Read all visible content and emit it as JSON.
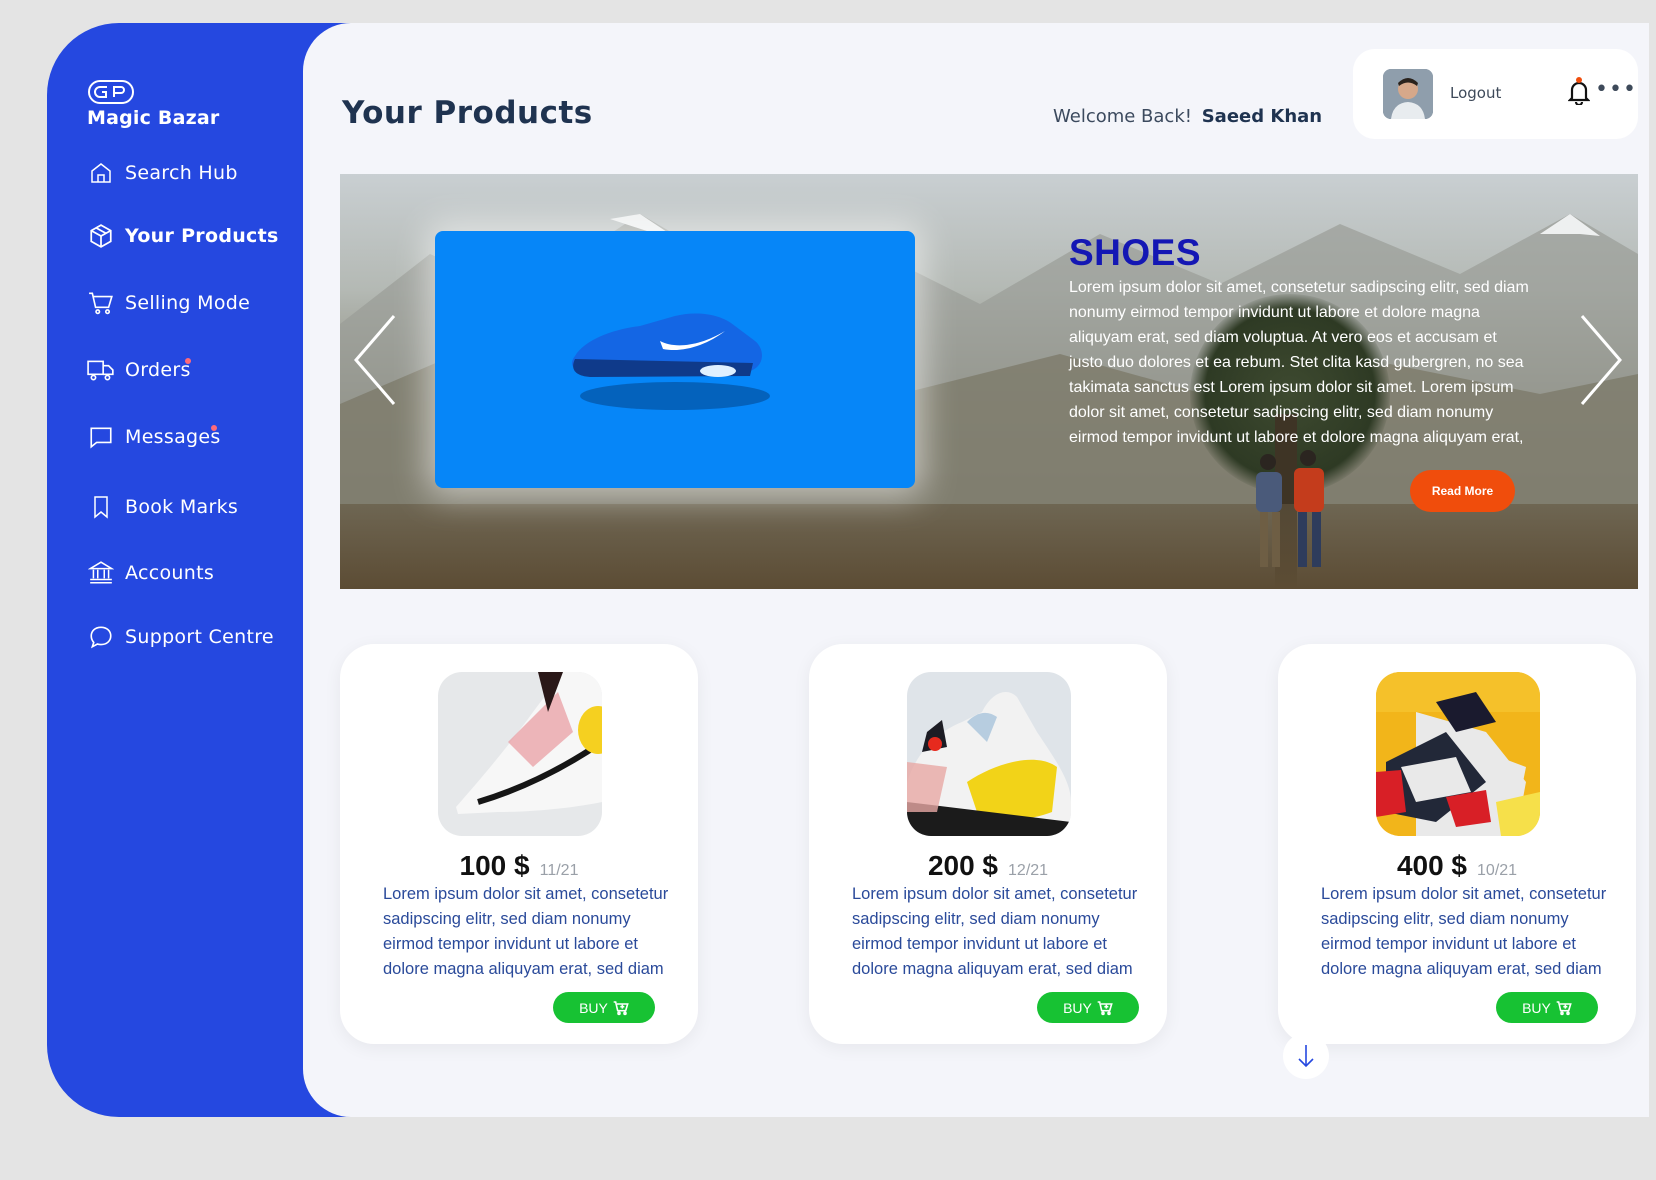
{
  "app": {
    "name": "Magic Bazar"
  },
  "sidebar": {
    "items": [
      {
        "label": "Search Hub",
        "icon": "home-icon"
      },
      {
        "label": "Your Products",
        "icon": "box-icon"
      },
      {
        "label": "Selling Mode",
        "icon": "cart-icon"
      },
      {
        "label": "Orders",
        "icon": "truck-icon"
      },
      {
        "label": "Messages",
        "icon": "message-icon"
      },
      {
        "label": "Book Marks",
        "icon": "bookmark-icon"
      },
      {
        "label": "Accounts",
        "icon": "bank-icon"
      },
      {
        "label": "Support Centre",
        "icon": "chat-bubble-icon"
      }
    ]
  },
  "header": {
    "title": "Your Products",
    "welcome_text": "Welcome Back!",
    "user_name": "Saeed Khan",
    "logout_label": "Logout"
  },
  "banner": {
    "title": "SHOES",
    "text": "Lorem ipsum dolor sit amet, consetetur sadipscing elitr, sed diam nonumy eirmod tempor invidunt ut labore et dolore magna aliquyam erat, sed diam voluptua. At vero eos et accusam et justo duo dolores et ea rebum. Stet clita kasd gubergren, no sea takimata sanctus est Lorem ipsum dolor sit amet. Lorem ipsum dolor sit amet, consetetur sadipscing elitr, sed diam nonumy eirmod tempor invidunt ut labore et dolore magna aliquyam erat,",
    "button_label": "Read More"
  },
  "products": [
    {
      "price": "100 $",
      "date": "11/21",
      "description": "Lorem ipsum dolor sit amet, consetetur sadipscing elitr, sed diam nonumy eirmod tempor invidunt ut labore et dolore magna aliquyam erat, sed diam",
      "button_label": "BUY"
    },
    {
      "price": "200 $",
      "date": "12/21",
      "description": "Lorem ipsum dolor sit amet, consetetur sadipscing elitr, sed diam nonumy eirmod tempor invidunt ut labore et dolore magna aliquyam erat, sed diam",
      "button_label": "BUY"
    },
    {
      "price": "400 $",
      "date": "10/21",
      "description": "Lorem ipsum dolor sit amet, consetetur sadipscing elitr, sed diam nonumy eirmod tempor invidunt ut labore et dolore magna aliquyam erat, sed diam",
      "button_label": "BUY"
    }
  ],
  "colors": {
    "sidebar": "#2548e0",
    "accent_orange": "#f04d0c",
    "buy_green": "#17c233",
    "banner_title": "#1417b4"
  }
}
